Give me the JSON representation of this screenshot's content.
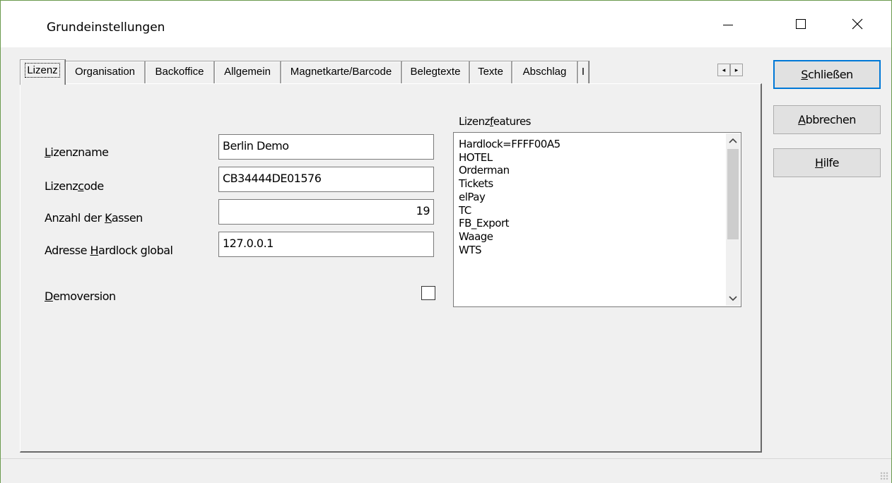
{
  "window": {
    "title": "Grundeinstellungen",
    "minimize_label": "—",
    "maximize_label": "☐",
    "close_label": "✕"
  },
  "tabs": [
    {
      "label": "Lizenz",
      "active": true
    },
    {
      "label": "Organisation"
    },
    {
      "label": "Backoffice"
    },
    {
      "label": "Allgemein"
    },
    {
      "label": "Magnetkarte/Barcode"
    },
    {
      "label": "Belegtexte"
    },
    {
      "label": "Texte"
    },
    {
      "label": "Abschlag"
    },
    {
      "label": "I"
    }
  ],
  "tab_scroll": {
    "left": "◂",
    "right": "▸"
  },
  "license": {
    "name_label_pre": "",
    "name_label_ul": "L",
    "name_label_post": "izenzname",
    "name_value": "Berlin Demo",
    "code_label_pre": "Lizenz",
    "code_label_ul": "c",
    "code_label_post": "ode",
    "code_value": "CB34444DE01576",
    "registers_label_pre": "Anzahl der ",
    "registers_label_ul": "K",
    "registers_label_post": "assen",
    "registers_value": "19",
    "hardlock_label_pre": "Adresse ",
    "hardlock_label_ul": "H",
    "hardlock_label_post": "ardlock global",
    "hardlock_value": "127.0.0.1",
    "demo_label_pre": "",
    "demo_label_ul": "D",
    "demo_label_post": "emoversion",
    "demo_checked": false
  },
  "features": {
    "label_pre": "Lizenz",
    "label_ul": "f",
    "label_post": "eatures",
    "items": [
      "Hardlock=FFFF00A5",
      "HOTEL",
      "Orderman",
      "Tickets",
      "elPay",
      "TC",
      "FB_Export",
      "Waage",
      "WTS"
    ]
  },
  "buttons": {
    "close_pre": "",
    "close_ul": "S",
    "close_post": "chließen",
    "cancel_pre": "",
    "cancel_ul": "A",
    "cancel_post": "bbrechen",
    "help_pre": "",
    "help_ul": "H",
    "help_post": "ilfe"
  }
}
